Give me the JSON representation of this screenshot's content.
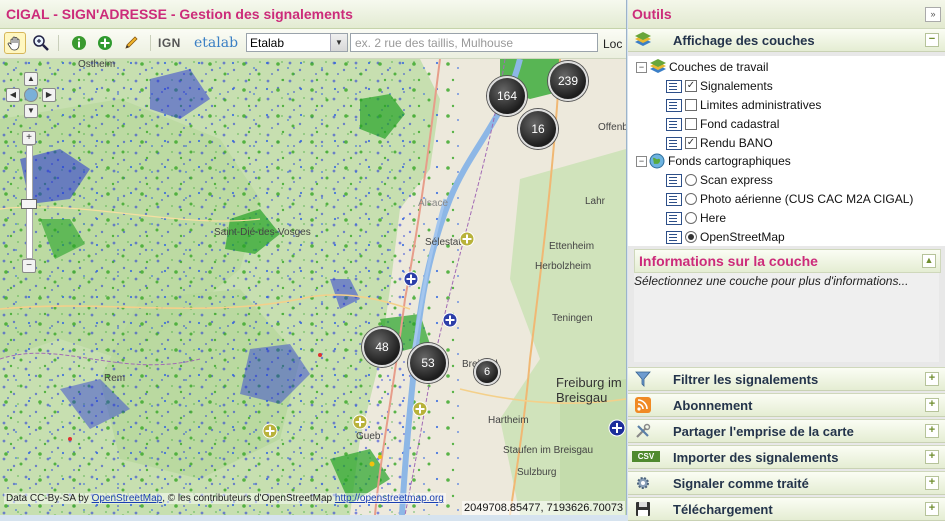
{
  "header": {
    "title": "CIGAL - SIGN'ADRESSE - Gestion des signalements"
  },
  "toolbar": {
    "ign_label": "IGN",
    "etalab_label": "etalab",
    "source_select_value": "Etalab",
    "address_placeholder": "ex. 2 rue des taillis, Mulhouse",
    "locate_label": "Loc"
  },
  "map": {
    "labels": [
      {
        "text": "Ostheim"
      },
      {
        "text": "Saint-Dié-des-Vosges"
      },
      {
        "text": "Offenburg"
      },
      {
        "text": "Lahr"
      },
      {
        "text": "Ettenheim"
      },
      {
        "text": "Herbolzheim"
      },
      {
        "text": "Teningen"
      },
      {
        "text": "Freiburg im Breisgau"
      },
      {
        "text": "Hartheim"
      },
      {
        "text": "Staufen im Breisgau"
      },
      {
        "text": "Sulzburg"
      },
      {
        "text": "Alsace"
      },
      {
        "text": "Sélestat"
      },
      {
        "text": "Gueb"
      },
      {
        "text": "Breisach am Rhein"
      },
      {
        "text": "Rem"
      }
    ],
    "clusters": [
      {
        "count": "239"
      },
      {
        "count": "164"
      },
      {
        "count": "16"
      },
      {
        "count": "48"
      },
      {
        "count": "53"
      },
      {
        "count": "6"
      }
    ],
    "attribution": {
      "prefix": "Data CC-By-SA by",
      "osm": "OpenStreetMap",
      "middle": ", © les contributeurs d'OpenStreetMap",
      "url": "http://openstreetmap.org"
    },
    "coords": "2049708.85477, 7193626.70073"
  },
  "panel": {
    "title": "Outils",
    "collapse_icon": "»",
    "sections_top": [
      {
        "label": "Affichage des couches",
        "toggle": "−"
      }
    ],
    "tree": {
      "working_group": "Couches de travail",
      "working_layers": [
        {
          "label": "Signalements",
          "checked": true
        },
        {
          "label": "Limites administratives",
          "checked": false
        },
        {
          "label": "Fond cadastral",
          "checked": false
        },
        {
          "label": "Rendu BANO",
          "checked": true
        }
      ],
      "base_group": "Fonds cartographiques",
      "base_layers": [
        {
          "label": "Scan express",
          "selected": false
        },
        {
          "label": "Photo aérienne (CUS CAC M2A CIGAL)",
          "selected": false
        },
        {
          "label": "Here",
          "selected": false
        },
        {
          "label": "OpenStreetMap",
          "selected": true
        }
      ]
    },
    "info": {
      "title": "Informations sur la couche",
      "text": "Sélectionnez une couche pour plus d'informations..."
    },
    "sections_bottom": [
      {
        "label": "Filtrer les signalements",
        "icon": "filter-icon",
        "toggle": "+"
      },
      {
        "label": "Abonnement",
        "icon": "rss-icon",
        "toggle": "+"
      },
      {
        "label": "Partager l'emprise de la carte",
        "icon": "tools-icon",
        "toggle": "+"
      },
      {
        "label": "Importer des signalements",
        "icon": "csv-icon",
        "icon_text": "CSV",
        "toggle": "+"
      },
      {
        "label": "Signaler comme traité",
        "icon": "gear-icon",
        "toggle": "+"
      },
      {
        "label": "Téléchargement",
        "icon": "save-icon",
        "toggle": "+"
      }
    ]
  }
}
